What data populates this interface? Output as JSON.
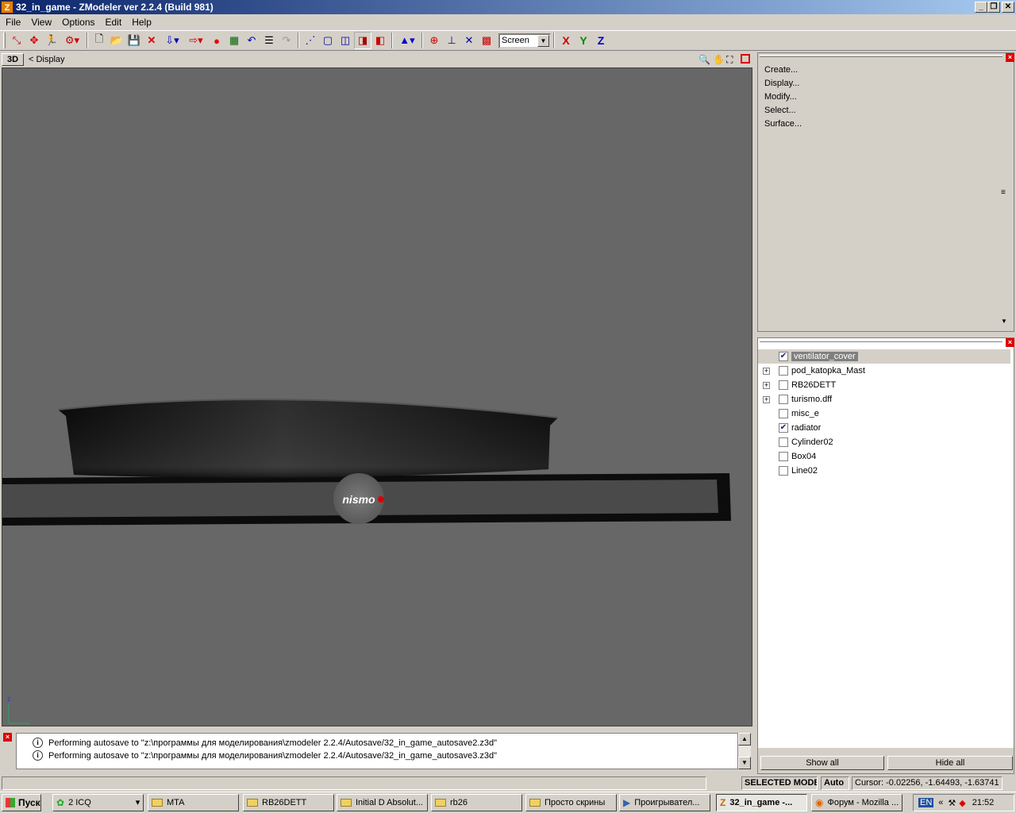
{
  "window": {
    "title": "32_in_game - ZModeler ver 2.2.4 (Build 981)",
    "app_icon": "Z"
  },
  "menu": {
    "file": "File",
    "view": "View",
    "options": "Options",
    "edit": "Edit",
    "help": "Help"
  },
  "toolbar": {
    "coord_system": "Screen",
    "axis_x": "X",
    "axis_y": "Y",
    "axis_z": "Z"
  },
  "viewport": {
    "mode": "3D",
    "label": "< Display",
    "logo_text": "nismo",
    "axis_z_label": "z"
  },
  "commands": {
    "items": [
      "Create...",
      "Display...",
      "Modify...",
      "Select...",
      "Surface..."
    ]
  },
  "objects": {
    "items": [
      {
        "name": "ventilator_cover",
        "checked": true,
        "expandable": false,
        "selected": true
      },
      {
        "name": "pod_katopka_Mast",
        "checked": false,
        "expandable": true,
        "selected": false
      },
      {
        "name": "RB26DETT",
        "checked": false,
        "expandable": true,
        "selected": false
      },
      {
        "name": "turismo.dff",
        "checked": false,
        "expandable": true,
        "selected": false
      },
      {
        "name": "misc_e",
        "checked": false,
        "expandable": false,
        "selected": false
      },
      {
        "name": "radiator",
        "checked": true,
        "expandable": false,
        "selected": false
      },
      {
        "name": "Cylinder02",
        "checked": false,
        "expandable": false,
        "selected": false
      },
      {
        "name": "Box04",
        "checked": false,
        "expandable": false,
        "selected": false
      },
      {
        "name": "Line02",
        "checked": false,
        "expandable": false,
        "selected": false
      }
    ],
    "show_all": "Show all",
    "hide_all": "Hide all"
  },
  "log": {
    "lines": [
      "Performing autosave to \"z:\\программы для моделирования\\zmodeler 2.2.4/Autosave/32_in_game_autosave2.z3d\"",
      "Performing autosave to \"z:\\программы для моделирования\\zmodeler 2.2.4/Autosave/32_in_game_autosave3.z3d\""
    ]
  },
  "status": {
    "mode": "SELECTED MODE",
    "snap": "Auto",
    "cursor": "Cursor: -0.02256, -1.64493, -1.63741"
  },
  "taskbar": {
    "start": "Пуск",
    "tasks": [
      {
        "label": "2 ICQ",
        "icon": "icq-icon"
      },
      {
        "label": "MTA",
        "icon": "folder-icon"
      },
      {
        "label": "RB26DETT",
        "icon": "folder-icon"
      },
      {
        "label": "Initial D Absolut...",
        "icon": "folder-icon"
      },
      {
        "label": "rb26",
        "icon": "folder-icon"
      },
      {
        "label": "Просто скрины",
        "icon": "folder-icon"
      },
      {
        "label": "Проигрывател...",
        "icon": "player-icon"
      },
      {
        "label": "32_in_game -...",
        "icon": "zmodeler-icon",
        "active": true
      },
      {
        "label": "Форум - Mozilla ...",
        "icon": "firefox-icon"
      }
    ],
    "lang": "EN",
    "time": "21:52"
  },
  "colors": {
    "title_gradient_start": "#0a246a",
    "viewport_bg": "#676767",
    "face": "#d4d0c8"
  }
}
